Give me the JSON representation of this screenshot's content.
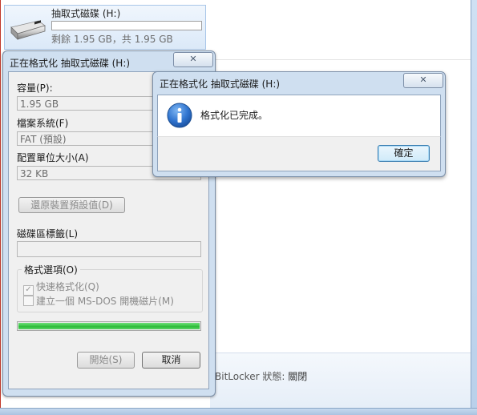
{
  "explorer": {
    "drive_name": "抽取式磁碟 (H:)",
    "drive_space": "剩餘 1.95 GB，共 1.95 GB",
    "drive_used_fraction": 0.0,
    "bitlocker_key": "BitLocker 狀態:",
    "bitlocker_value": "關閉"
  },
  "format_dialog": {
    "title": "正在格式化 抽取式磁碟 (H:)",
    "close_glyph": "✕",
    "capacity_label": "容量(P):",
    "capacity_value": "1.95 GB",
    "fs_label": "檔案系統(F)",
    "fs_value": "FAT (預設)",
    "alloc_label": "配置單位大小(A)",
    "alloc_value": "32 KB",
    "restore_label": "還原裝置預設值(D)",
    "volume_label": "磁碟區標籤(L)",
    "volume_value": "",
    "options_label": "格式選項(O)",
    "quick_format_label": "快速格式化(Q)",
    "quick_format_checked": true,
    "msdos_label": "建立一個 MS-DOS 開機磁片(M)",
    "msdos_checked": false,
    "progress": 1.0,
    "start_label": "開始(S)",
    "close_label": "取消"
  },
  "message_box": {
    "title": "正在格式化 抽取式磁碟 (H:)",
    "close_glyph": "✕",
    "icon": "info-icon",
    "text": "格式化已完成。",
    "ok_label": "確定"
  },
  "colors": {
    "progress_green": "#2dbb39",
    "dialog_frame": "#cfdff0",
    "info_blue": "#1f5fb4"
  }
}
